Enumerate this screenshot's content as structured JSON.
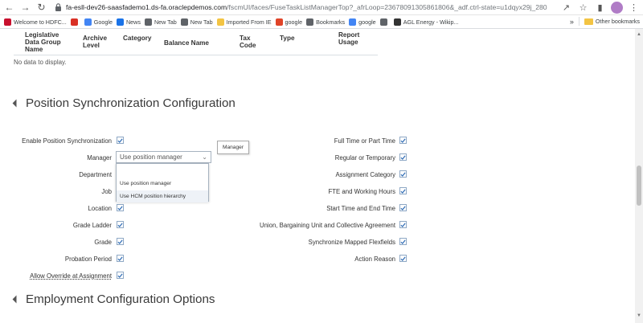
{
  "browser": {
    "url_host": "fa-esll-dev26-saasfademo1.ds-fa.oraclepdemos.com",
    "url_path": "/fscmUI/faces/FuseTaskListManagerTop?_afrLoop=23678091305861806&_adf.ctrl-state=u1dqyx29j_280",
    "bookmarks": [
      {
        "label": "Welcome to HDFC...",
        "color": "#c8102e",
        "icon": "hdfc-icon"
      },
      {
        "label": "",
        "color": "#d93025",
        "icon": "gmail-icon"
      },
      {
        "label": "Google",
        "color": "#4285f4",
        "icon": "google-icon"
      },
      {
        "label": "News",
        "color": "#1a73e8",
        "icon": "news-icon"
      },
      {
        "label": "New Tab",
        "color": "#5f6368",
        "icon": "globe-icon"
      },
      {
        "label": "New Tab",
        "color": "#5f6368",
        "icon": "globe-icon"
      },
      {
        "label": "Imported From IE",
        "color": "#f3c443",
        "icon": "folder-icon"
      },
      {
        "label": "google",
        "color": "#e04428",
        "icon": "opera-icon"
      },
      {
        "label": "Bookmarks",
        "color": "#5f6368",
        "icon": "star-icon"
      },
      {
        "label": "google",
        "color": "#4285f4",
        "icon": "google-icon"
      },
      {
        "label": "",
        "color": "#5f6368",
        "icon": "globe-icon"
      },
      {
        "label": "AGL Energy - Wikip...",
        "color": "#333333",
        "icon": "wikipedia-icon"
      }
    ],
    "other_bookmarks": "Other bookmarks",
    "overflow": "»"
  },
  "table": {
    "headers": [
      "Legislative Data Group Name",
      "Archive Level",
      "Category",
      "Balance Name",
      "Tax Code",
      "Type",
      "Report Usage"
    ],
    "empty_text": "No data to display."
  },
  "position_sync": {
    "title": "Position Synchronization Configuration",
    "left_fields": [
      {
        "label": "Enable Position Synchronization",
        "checked": true
      },
      {
        "label": "Manager"
      },
      {
        "label": "Department"
      },
      {
        "label": "Job"
      },
      {
        "label": "Location",
        "checked": true
      },
      {
        "label": "Grade Ladder",
        "checked": true
      },
      {
        "label": "Grade",
        "checked": true
      },
      {
        "label": "Probation Period",
        "checked": true
      },
      {
        "label": "Allow Override at Assignment",
        "checked": true
      }
    ],
    "right_fields": [
      {
        "label": "Full Time or Part Time",
        "checked": true
      },
      {
        "label": "Regular or Temporary",
        "checked": true
      },
      {
        "label": "Assignment Category",
        "checked": true
      },
      {
        "label": "FTE and Working Hours",
        "checked": true
      },
      {
        "label": "Start Time and End Time",
        "checked": true
      },
      {
        "label": "Union, Bargaining Unit and Collective Agreement",
        "checked": true
      },
      {
        "label": "Synchronize Mapped Flexfields",
        "checked": true
      },
      {
        "label": "Action Reason",
        "checked": true
      }
    ],
    "manager_select": {
      "value": "Use position manager",
      "options": [
        "Use position manager",
        "Use HCM position hierarchy"
      ],
      "tooltip": "Manager"
    }
  },
  "employment": {
    "title": "Employment Configuration Options"
  },
  "colors": {
    "check": "#2f6cb5",
    "section_title": "#3a3a3a"
  }
}
